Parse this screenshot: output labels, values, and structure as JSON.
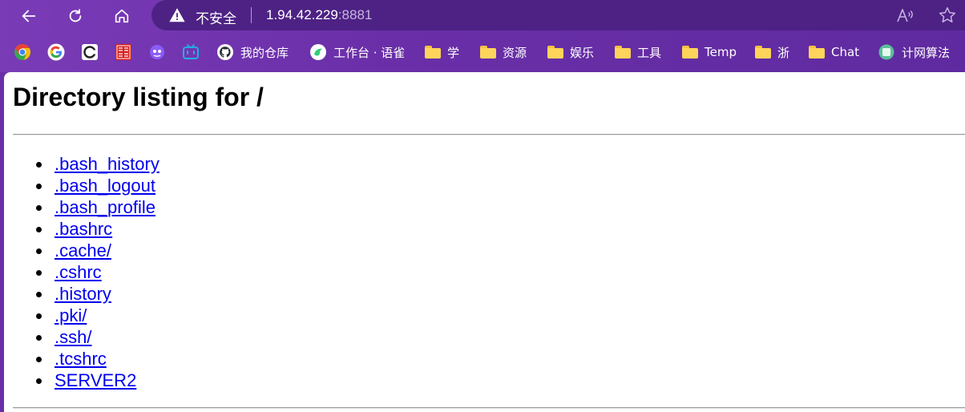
{
  "browser": {
    "address": {
      "security_label": "不安全",
      "host": "1.94.42.229",
      "port": ":8881"
    },
    "bookmarks": [
      {
        "icon": "chrome-colored-icon",
        "label": ""
      },
      {
        "icon": "google-icon",
        "label": ""
      },
      {
        "icon": "cloudflare-c-icon",
        "label": ""
      },
      {
        "icon": "red-seal-icon",
        "label": ""
      },
      {
        "icon": "purple-app-icon",
        "label": ""
      },
      {
        "icon": "bilibili-tv-icon",
        "label": ""
      },
      {
        "icon": "github-icon",
        "label": "我的仓库"
      },
      {
        "icon": "yuque-icon",
        "label": "工作台 · 语雀"
      },
      {
        "icon": "folder-icon",
        "label": "学"
      },
      {
        "icon": "folder-icon",
        "label": "资源"
      },
      {
        "icon": "folder-icon",
        "label": "娱乐"
      },
      {
        "icon": "folder-icon",
        "label": "工具"
      },
      {
        "icon": "folder-icon",
        "label": "Temp"
      },
      {
        "icon": "folder-icon",
        "label": "浙"
      },
      {
        "icon": "folder-icon",
        "label": "Chat"
      },
      {
        "icon": "circle-app-icon",
        "label": "计网算法"
      }
    ]
  },
  "page": {
    "title": "Directory listing for /",
    "entries": [
      ".bash_history",
      ".bash_logout",
      ".bash_profile",
      ".bashrc",
      ".cache/",
      ".cshrc",
      ".history",
      ".pki/",
      ".ssh/",
      ".tcshrc",
      "SERVER2"
    ]
  },
  "colors": {
    "chrome": "#6a2fa8",
    "address_bar": "#4d2284",
    "link": "#0000ee"
  }
}
